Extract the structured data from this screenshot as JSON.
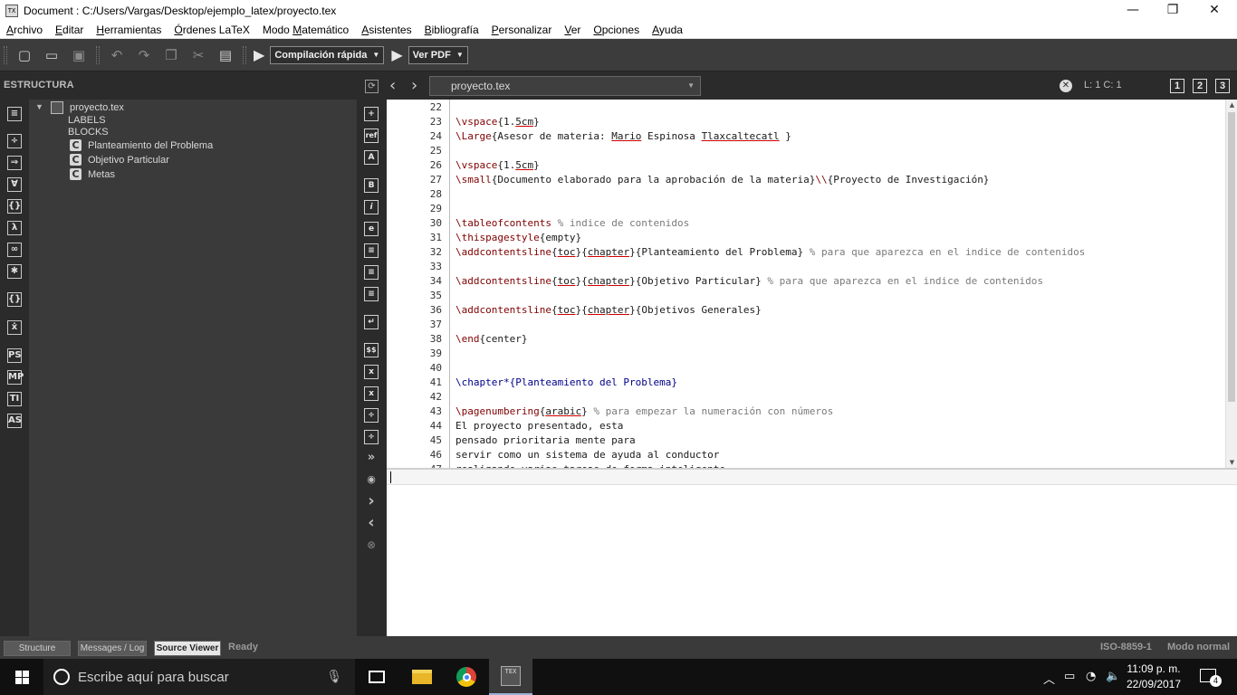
{
  "window": {
    "title": "Document : C:/Users/Vargas/Desktop/ejemplo_latex/proyecto.tex",
    "minimize": "—",
    "maximize": "❐",
    "close": "✕"
  },
  "menu": [
    {
      "pre": "",
      "u": "A",
      "post": "rchivo"
    },
    {
      "pre": "",
      "u": "E",
      "post": "ditar"
    },
    {
      "pre": "",
      "u": "H",
      "post": "erramientas"
    },
    {
      "pre": "",
      "u": "Ó",
      "post": "rdenes LaTeX"
    },
    {
      "pre": "Modo ",
      "u": "M",
      "post": "atemático"
    },
    {
      "pre": "",
      "u": "A",
      "post": "sistentes"
    },
    {
      "pre": "",
      "u": "B",
      "post": "ibliografía"
    },
    {
      "pre": "",
      "u": "P",
      "post": "ersonalizar"
    },
    {
      "pre": "",
      "u": "V",
      "post": "er"
    },
    {
      "pre": "",
      "u": "O",
      "post": "pciones"
    },
    {
      "pre": "",
      "u": "A",
      "post": "yuda"
    }
  ],
  "toolbar": {
    "compile_combo": "Compilación rápida",
    "view_combo": "Ver PDF"
  },
  "structure": {
    "header": "ESTRUCTURA",
    "root": "proyecto.tex",
    "labels": "LABELS",
    "blocks": "BLOCKS",
    "chapters": [
      "Planteamiento del Problema",
      "Objetivo Particular",
      "Metas"
    ]
  },
  "editor": {
    "file_tab": "proyecto.tex",
    "cursor": "L: 1 C: 1",
    "view_buttons": [
      "1",
      "2",
      "3"
    ],
    "lines": [
      {
        "n": "22",
        "t": []
      },
      {
        "n": "23",
        "t": [
          [
            "cmd",
            "\\vspace"
          ],
          [
            "arg",
            "{1."
          ],
          [
            "ul",
            "5cm"
          ],
          [
            "arg",
            "}"
          ]
        ]
      },
      {
        "n": "24",
        "t": [
          [
            "cmd",
            "\\Large"
          ],
          [
            "arg",
            "{Asesor de materia: "
          ],
          [
            "ul",
            "Mario"
          ],
          [
            "arg",
            " Espinosa "
          ],
          [
            "ul",
            "Tlaxcaltecatl"
          ],
          [
            "arg",
            " }"
          ]
        ]
      },
      {
        "n": "25",
        "t": []
      },
      {
        "n": "26",
        "t": [
          [
            "cmd",
            "\\vspace"
          ],
          [
            "arg",
            "{1."
          ],
          [
            "ul",
            "5cm"
          ],
          [
            "arg",
            "}"
          ]
        ]
      },
      {
        "n": "27",
        "t": [
          [
            "cmd",
            "\\small"
          ],
          [
            "arg",
            "{Documento elaborado para la aprobación de la materia}"
          ],
          [
            "cmd",
            "\\\\"
          ],
          [
            "arg",
            "{Proyecto de Investigación}"
          ]
        ]
      },
      {
        "n": "28",
        "t": []
      },
      {
        "n": "29",
        "t": []
      },
      {
        "n": "30",
        "t": [
          [
            "cmd",
            "\\tableofcontents"
          ],
          [
            "cmt",
            " % indice de contenidos"
          ]
        ]
      },
      {
        "n": "31",
        "t": [
          [
            "cmd",
            "\\thispagestyle"
          ],
          [
            "arg",
            "{empty}"
          ]
        ]
      },
      {
        "n": "32",
        "t": [
          [
            "cmd",
            "\\addcontentsline"
          ],
          [
            "arg",
            "{"
          ],
          [
            "ul",
            "toc"
          ],
          [
            "arg",
            "}{"
          ],
          [
            "ul",
            "chapter"
          ],
          [
            "arg",
            "}{Planteamiento del Problema}"
          ],
          [
            "cmt",
            " % para que aparezca en el indice de contenidos"
          ]
        ]
      },
      {
        "n": "33",
        "t": []
      },
      {
        "n": "34",
        "t": [
          [
            "cmd",
            "\\addcontentsline"
          ],
          [
            "arg",
            "{"
          ],
          [
            "ul",
            "toc"
          ],
          [
            "arg",
            "}{"
          ],
          [
            "ul",
            "chapter"
          ],
          [
            "arg",
            "}{Objetivo Particular}"
          ],
          [
            "cmt",
            " % para que aparezca en el indice de contenidos"
          ]
        ]
      },
      {
        "n": "35",
        "t": []
      },
      {
        "n": "36",
        "t": [
          [
            "cmd",
            "\\addcontentsline"
          ],
          [
            "arg",
            "{"
          ],
          [
            "ul",
            "toc"
          ],
          [
            "arg",
            "}{"
          ],
          [
            "ul",
            "chapter"
          ],
          [
            "arg",
            "}{Objetivos Generales}"
          ]
        ]
      },
      {
        "n": "37",
        "t": []
      },
      {
        "n": "38",
        "t": [
          [
            "cmd",
            "\\end"
          ],
          [
            "arg",
            "{center}"
          ]
        ]
      },
      {
        "n": "39",
        "t": []
      },
      {
        "n": "40",
        "t": []
      },
      {
        "n": "41",
        "t": [
          [
            "chap",
            "\\chapter*{Planteamiento del Problema}"
          ]
        ]
      },
      {
        "n": "42",
        "t": []
      },
      {
        "n": "43",
        "t": [
          [
            "cmd",
            "\\pagenumbering"
          ],
          [
            "arg",
            "{"
          ],
          [
            "ul",
            "arabic"
          ],
          [
            "arg",
            "}"
          ],
          [
            "cmt",
            " % para empezar la numeración con números"
          ]
        ]
      },
      {
        "n": "44",
        "t": [
          [
            "arg",
            "El proyecto presentado, esta"
          ]
        ]
      },
      {
        "n": "45",
        "t": [
          [
            "arg",
            "pensado prioritaria mente para"
          ]
        ]
      },
      {
        "n": "46",
        "t": [
          [
            "arg",
            "servir como un sistema de ayuda al conductor"
          ]
        ]
      },
      {
        "n": "47",
        "t": [
          [
            "arg",
            "realizando varias tareas de forma inteligente"
          ]
        ]
      }
    ]
  },
  "statusbar": {
    "tabs": [
      "Structure",
      "Messages / Log",
      "Source Viewer"
    ],
    "active_tab": "Source Viewer",
    "status": "Ready",
    "encoding": "ISO-8859-1",
    "mode": "Modo normal"
  },
  "taskbar": {
    "search_placeholder": "Escribe aquí para buscar",
    "time": "11:09 p. m.",
    "date": "22/09/2017",
    "notifications": "4"
  }
}
